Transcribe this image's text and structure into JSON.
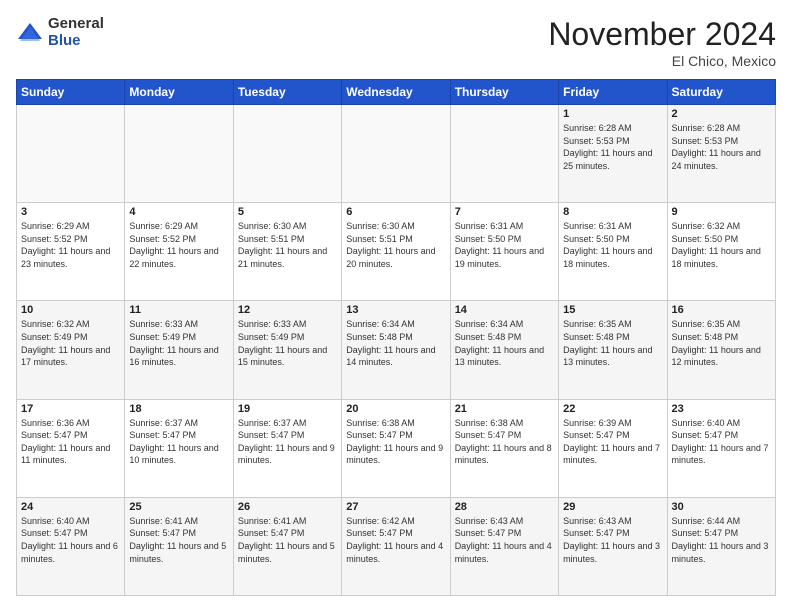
{
  "logo": {
    "general": "General",
    "blue": "Blue"
  },
  "header": {
    "month": "November 2024",
    "location": "El Chico, Mexico"
  },
  "days_of_week": [
    "Sunday",
    "Monday",
    "Tuesday",
    "Wednesday",
    "Thursday",
    "Friday",
    "Saturday"
  ],
  "weeks": [
    [
      {
        "day": "",
        "info": ""
      },
      {
        "day": "",
        "info": ""
      },
      {
        "day": "",
        "info": ""
      },
      {
        "day": "",
        "info": ""
      },
      {
        "day": "",
        "info": ""
      },
      {
        "day": "1",
        "info": "Sunrise: 6:28 AM\nSunset: 5:53 PM\nDaylight: 11 hours and 25 minutes."
      },
      {
        "day": "2",
        "info": "Sunrise: 6:28 AM\nSunset: 5:53 PM\nDaylight: 11 hours and 24 minutes."
      }
    ],
    [
      {
        "day": "3",
        "info": "Sunrise: 6:29 AM\nSunset: 5:52 PM\nDaylight: 11 hours and 23 minutes."
      },
      {
        "day": "4",
        "info": "Sunrise: 6:29 AM\nSunset: 5:52 PM\nDaylight: 11 hours and 22 minutes."
      },
      {
        "day": "5",
        "info": "Sunrise: 6:30 AM\nSunset: 5:51 PM\nDaylight: 11 hours and 21 minutes."
      },
      {
        "day": "6",
        "info": "Sunrise: 6:30 AM\nSunset: 5:51 PM\nDaylight: 11 hours and 20 minutes."
      },
      {
        "day": "7",
        "info": "Sunrise: 6:31 AM\nSunset: 5:50 PM\nDaylight: 11 hours and 19 minutes."
      },
      {
        "day": "8",
        "info": "Sunrise: 6:31 AM\nSunset: 5:50 PM\nDaylight: 11 hours and 18 minutes."
      },
      {
        "day": "9",
        "info": "Sunrise: 6:32 AM\nSunset: 5:50 PM\nDaylight: 11 hours and 18 minutes."
      }
    ],
    [
      {
        "day": "10",
        "info": "Sunrise: 6:32 AM\nSunset: 5:49 PM\nDaylight: 11 hours and 17 minutes."
      },
      {
        "day": "11",
        "info": "Sunrise: 6:33 AM\nSunset: 5:49 PM\nDaylight: 11 hours and 16 minutes."
      },
      {
        "day": "12",
        "info": "Sunrise: 6:33 AM\nSunset: 5:49 PM\nDaylight: 11 hours and 15 minutes."
      },
      {
        "day": "13",
        "info": "Sunrise: 6:34 AM\nSunset: 5:48 PM\nDaylight: 11 hours and 14 minutes."
      },
      {
        "day": "14",
        "info": "Sunrise: 6:34 AM\nSunset: 5:48 PM\nDaylight: 11 hours and 13 minutes."
      },
      {
        "day": "15",
        "info": "Sunrise: 6:35 AM\nSunset: 5:48 PM\nDaylight: 11 hours and 13 minutes."
      },
      {
        "day": "16",
        "info": "Sunrise: 6:35 AM\nSunset: 5:48 PM\nDaylight: 11 hours and 12 minutes."
      }
    ],
    [
      {
        "day": "17",
        "info": "Sunrise: 6:36 AM\nSunset: 5:47 PM\nDaylight: 11 hours and 11 minutes."
      },
      {
        "day": "18",
        "info": "Sunrise: 6:37 AM\nSunset: 5:47 PM\nDaylight: 11 hours and 10 minutes."
      },
      {
        "day": "19",
        "info": "Sunrise: 6:37 AM\nSunset: 5:47 PM\nDaylight: 11 hours and 9 minutes."
      },
      {
        "day": "20",
        "info": "Sunrise: 6:38 AM\nSunset: 5:47 PM\nDaylight: 11 hours and 9 minutes."
      },
      {
        "day": "21",
        "info": "Sunrise: 6:38 AM\nSunset: 5:47 PM\nDaylight: 11 hours and 8 minutes."
      },
      {
        "day": "22",
        "info": "Sunrise: 6:39 AM\nSunset: 5:47 PM\nDaylight: 11 hours and 7 minutes."
      },
      {
        "day": "23",
        "info": "Sunrise: 6:40 AM\nSunset: 5:47 PM\nDaylight: 11 hours and 7 minutes."
      }
    ],
    [
      {
        "day": "24",
        "info": "Sunrise: 6:40 AM\nSunset: 5:47 PM\nDaylight: 11 hours and 6 minutes."
      },
      {
        "day": "25",
        "info": "Sunrise: 6:41 AM\nSunset: 5:47 PM\nDaylight: 11 hours and 5 minutes."
      },
      {
        "day": "26",
        "info": "Sunrise: 6:41 AM\nSunset: 5:47 PM\nDaylight: 11 hours and 5 minutes."
      },
      {
        "day": "27",
        "info": "Sunrise: 6:42 AM\nSunset: 5:47 PM\nDaylight: 11 hours and 4 minutes."
      },
      {
        "day": "28",
        "info": "Sunrise: 6:43 AM\nSunset: 5:47 PM\nDaylight: 11 hours and 4 minutes."
      },
      {
        "day": "29",
        "info": "Sunrise: 6:43 AM\nSunset: 5:47 PM\nDaylight: 11 hours and 3 minutes."
      },
      {
        "day": "30",
        "info": "Sunrise: 6:44 AM\nSunset: 5:47 PM\nDaylight: 11 hours and 3 minutes."
      }
    ]
  ]
}
